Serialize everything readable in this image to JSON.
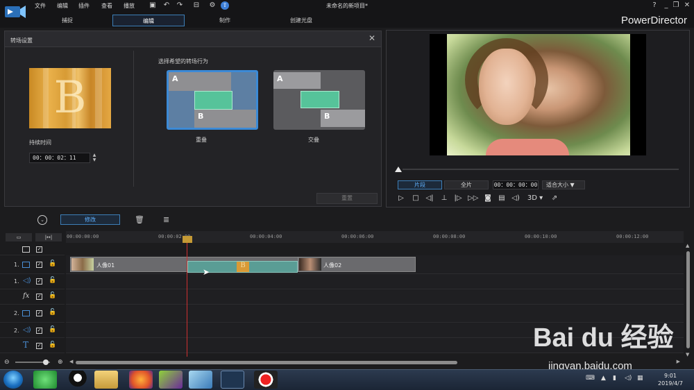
{
  "menu": {
    "items": [
      "文件",
      "编辑",
      "插件",
      "查看",
      "播放"
    ],
    "title": "未命名的新项目*",
    "help": "?",
    "tabs": [
      {
        "label": "捕捉",
        "active": false
      },
      {
        "label": "编辑",
        "active": true
      },
      {
        "label": "制作",
        "active": false
      },
      {
        "label": "创建光盘",
        "active": false
      }
    ],
    "brand": "PowerDirector"
  },
  "transition_panel": {
    "title": "转场设置",
    "duration_label": "持续时间",
    "duration_value": "00：00：02：11",
    "behavior_label": "选择希望的转场行为",
    "options": [
      {
        "label": "重叠",
        "selected": true
      },
      {
        "label": "交叠",
        "selected": false
      }
    ],
    "letter_a": "A",
    "letter_b": "B",
    "thumb_letter": "B",
    "reset_label": "重置"
  },
  "preview": {
    "clip_label": "片段",
    "full_label": "全片",
    "timecode": "00：00：00：00",
    "fit_label": "适合大小",
    "mode_3d": "3D"
  },
  "timeline": {
    "modify_label": "修改",
    "ruler": [
      "00:00:00:00",
      "00:00:02:00",
      "00:00:04:00",
      "00:00:06:00",
      "00:00:08:00",
      "00:00:10:00",
      "00:00:12:00"
    ],
    "tracks": [
      {
        "num": "",
        "kind": "video-all"
      },
      {
        "num": "1.",
        "kind": "video"
      },
      {
        "num": "1.",
        "kind": "audio"
      },
      {
        "num": "",
        "kind": "fx"
      },
      {
        "num": "2.",
        "kind": "video"
      },
      {
        "num": "2.",
        "kind": "audio"
      },
      {
        "num": "",
        "kind": "text"
      }
    ],
    "clips": [
      {
        "label": "人像01"
      },
      {
        "label": "人像02"
      }
    ],
    "transition_letter": "B"
  },
  "taskbar": {
    "time": "9:01",
    "date": "2019/4/7"
  },
  "watermark": {
    "line1": "Bai du 经验",
    "line2": "jingyan.baidu.com"
  }
}
